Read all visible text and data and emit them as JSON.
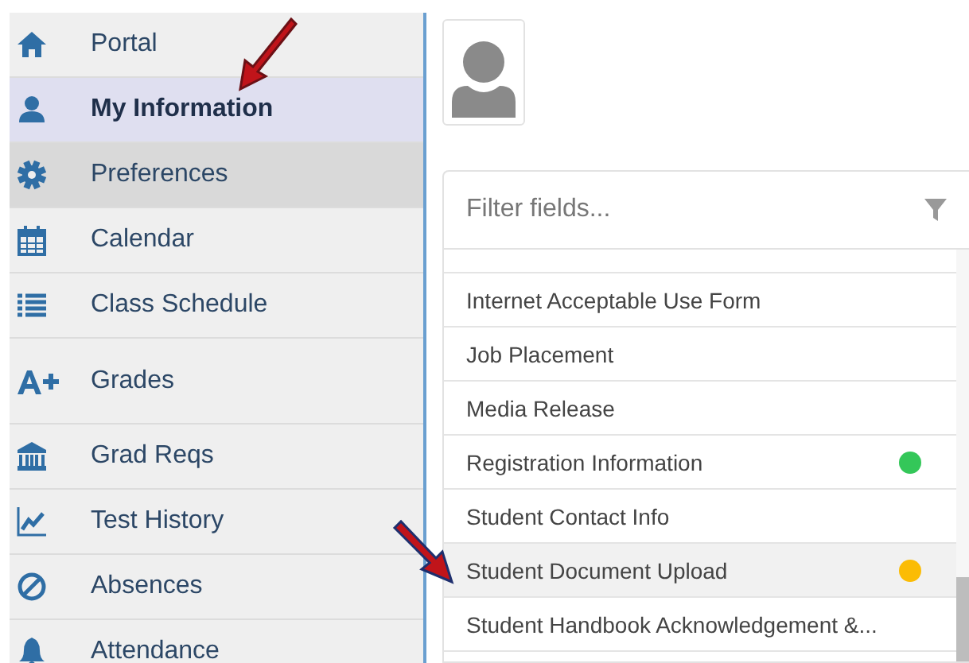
{
  "sidebar": {
    "items": [
      {
        "label": "Portal",
        "selected": false,
        "hovered": false
      },
      {
        "label": "My Information",
        "selected": true,
        "hovered": false
      },
      {
        "label": "Preferences",
        "selected": false,
        "hovered": true
      },
      {
        "label": "Calendar",
        "selected": false,
        "hovered": false
      },
      {
        "label": "Class Schedule",
        "selected": false,
        "hovered": false
      },
      {
        "label": "Grades",
        "selected": false,
        "hovered": false
      },
      {
        "label": "Grad Reqs",
        "selected": false,
        "hovered": false
      },
      {
        "label": "Test History",
        "selected": false,
        "hovered": false
      },
      {
        "label": "Absences",
        "selected": false,
        "hovered": false
      },
      {
        "label": "Attendance",
        "selected": false,
        "hovered": false
      }
    ]
  },
  "fields_panel": {
    "filter": {
      "placeholder": "Filter fields..."
    },
    "rows": [
      {
        "label": "Internet Acceptable Use Form",
        "highlighted": false
      },
      {
        "label": "Job Placement",
        "highlighted": false
      },
      {
        "label": "Media Release",
        "highlighted": false
      },
      {
        "label": "Registration Information",
        "highlighted": false,
        "color": "#34c759"
      },
      {
        "label": "Student Contact Info",
        "highlighted": false
      },
      {
        "label": "Student Document Upload",
        "highlighted": true,
        "color": "#fbbc05"
      },
      {
        "label": "Student Handbook Acknowledgement &...",
        "highlighted": false
      }
    ]
  }
}
